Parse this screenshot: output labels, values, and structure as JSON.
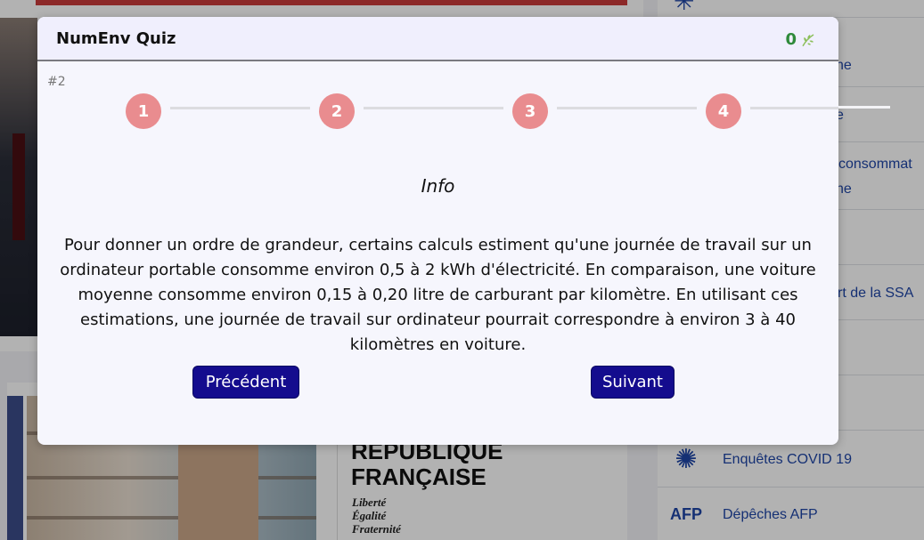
{
  "background": {
    "right_links": [
      {
        "label": "ne"
      },
      {
        "label": "e"
      },
      {
        "label": "consommat"
      },
      {
        "label": "ne"
      },
      {
        "label": "rt de la SSA"
      },
      {
        "label": "Enquêtes COVID 19"
      },
      {
        "label": "Dépêches AFP"
      }
    ],
    "afp_logo": "AFP",
    "republique": {
      "title_line1": "RÉPUBLIQUE",
      "title_line2": "FRANÇAISE",
      "motto1": "Liberté",
      "motto2": "Égalité",
      "motto3": "Fraternité"
    }
  },
  "modal": {
    "title": "NumEnv Quiz",
    "score": "0",
    "score_icon": "leaf-icon",
    "question_number": "#2",
    "steps": [
      "1",
      "2",
      "3",
      "4"
    ],
    "info_heading": "Info",
    "info_text": "Pour donner un ordre de grandeur, certains calculs estiment qu'une journée de travail sur un ordinateur portable consomme environ 0,5 à 2 kWh d'électricité. En comparaison, une voiture moyenne consomme environ 0,15 à 0,20 litre de carburant par kilomètre. En utilisant ces estimations, une journée de travail sur ordinateur pourrait correspondre à environ 3 à 40 kilomètres en voiture.",
    "prev_label": "Précédent",
    "next_label": "Suivant"
  },
  "colors": {
    "step_circle": "#e98c8f",
    "button_bg": "#140c8e",
    "score_green": "#2f8a3b"
  }
}
